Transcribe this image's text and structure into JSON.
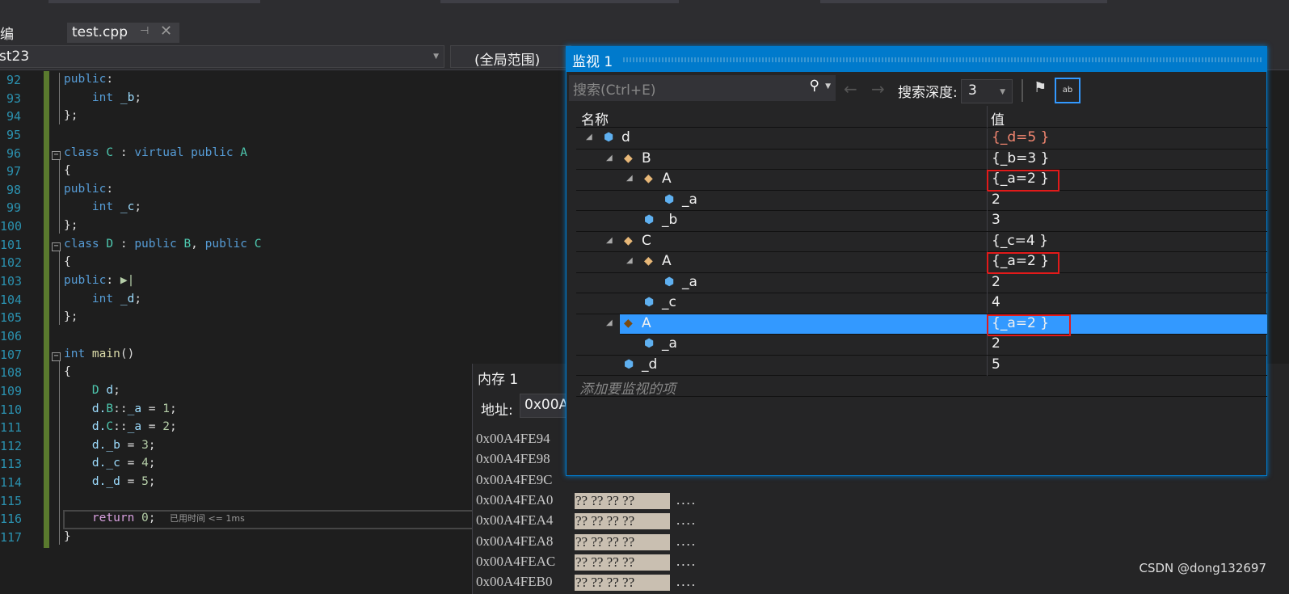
{
  "tabs": {
    "left_partial": "编",
    "active_file": "test.cpp",
    "pin_icon": "pin-icon",
    "close_icon": "close-icon"
  },
  "nav": {
    "project": "st23",
    "scope": "(全局范围)"
  },
  "editor": {
    "line_numbers": [
      "92",
      "93",
      "94",
      "95",
      "96",
      "97",
      "98",
      "99",
      "100",
      "101",
      "102",
      "103",
      "104",
      "105",
      "106",
      "107",
      "108",
      "109",
      "110",
      "111",
      "112",
      "113",
      "114",
      "115",
      "116",
      "117"
    ],
    "lines": [
      [
        [
          "public",
          "kw"
        ],
        [
          ":",
          "pl"
        ]
      ],
      [
        [
          "    int ",
          "kw"
        ],
        [
          "_b",
          "va"
        ],
        [
          ";",
          "pl"
        ]
      ],
      [
        [
          "};",
          "pl"
        ]
      ],
      [],
      [
        [
          "class ",
          "kw"
        ],
        [
          "C",
          "ty"
        ],
        [
          " : ",
          "pl"
        ],
        [
          "virtual public ",
          "kw"
        ],
        [
          "A",
          "ty"
        ]
      ],
      [
        [
          "{",
          "pl"
        ]
      ],
      [
        [
          "public",
          "kw"
        ],
        [
          ":",
          "pl"
        ]
      ],
      [
        [
          "    int ",
          "kw"
        ],
        [
          "_c",
          "va"
        ],
        [
          ";",
          "pl"
        ]
      ],
      [
        [
          "};",
          "pl"
        ]
      ],
      [
        [
          "class ",
          "kw"
        ],
        [
          "D",
          "ty"
        ],
        [
          " : ",
          "pl"
        ],
        [
          "public ",
          "kw"
        ],
        [
          "B",
          "ty"
        ],
        [
          ", ",
          "pl"
        ],
        [
          "public ",
          "kw"
        ],
        [
          "C",
          "ty"
        ]
      ],
      [
        [
          "{",
          "pl"
        ]
      ],
      [
        [
          "public",
          "kw"
        ],
        [
          ":",
          "pl"
        ],
        [
          " ▶|",
          "nu"
        ]
      ],
      [
        [
          "    int ",
          "kw"
        ],
        [
          "_d",
          "va"
        ],
        [
          ";",
          "pl"
        ]
      ],
      [
        [
          "};",
          "pl"
        ]
      ],
      [],
      [
        [
          "int ",
          "kw"
        ],
        [
          "main",
          "fn"
        ],
        [
          "()",
          "pl"
        ]
      ],
      [
        [
          "{",
          "pl"
        ]
      ],
      [
        [
          "    ",
          "pl"
        ],
        [
          "D ",
          "ty"
        ],
        [
          "d",
          "va"
        ],
        [
          ";",
          "pl"
        ]
      ],
      [
        [
          "    d.",
          "va"
        ],
        [
          "B",
          "ty"
        ],
        [
          "::",
          "pl"
        ],
        [
          "_a",
          "va"
        ],
        [
          " = ",
          "pl"
        ],
        [
          "1",
          "nu"
        ],
        [
          ";",
          "pl"
        ]
      ],
      [
        [
          "    d.",
          "va"
        ],
        [
          "C",
          "ty"
        ],
        [
          "::",
          "pl"
        ],
        [
          "_a",
          "va"
        ],
        [
          " = ",
          "pl"
        ],
        [
          "2",
          "nu"
        ],
        [
          ";",
          "pl"
        ]
      ],
      [
        [
          "    d.",
          "va"
        ],
        [
          "_b",
          "va"
        ],
        [
          " = ",
          "pl"
        ],
        [
          "3",
          "nu"
        ],
        [
          ";",
          "pl"
        ]
      ],
      [
        [
          "    d.",
          "va"
        ],
        [
          "_c",
          "va"
        ],
        [
          " = ",
          "pl"
        ],
        [
          "4",
          "nu"
        ],
        [
          ";",
          "pl"
        ]
      ],
      [
        [
          "    d.",
          "va"
        ],
        [
          "_d",
          "va"
        ],
        [
          " = ",
          "pl"
        ],
        [
          "5",
          "nu"
        ],
        [
          ";",
          "pl"
        ]
      ],
      [],
      [
        [
          "    return ",
          "rt"
        ],
        [
          "0",
          "nu"
        ],
        [
          ";",
          "pl"
        ]
      ],
      [
        [
          "}",
          "pl"
        ]
      ]
    ],
    "perf_hint": "已用时间 <= 1ms"
  },
  "memory": {
    "title": "内存 1",
    "address_label": "地址:",
    "address_value": "0x00A",
    "rows": [
      {
        "addr": "0x00A4FE94",
        "bytes": "",
        "chars": ""
      },
      {
        "addr": "0x00A4FE98",
        "bytes": "",
        "chars": ""
      },
      {
        "addr": "0x00A4FE9C",
        "bytes": "",
        "chars": ""
      },
      {
        "addr": "0x00A4FEA0",
        "bytes": "?? ?? ?? ??",
        "chars": "...."
      },
      {
        "addr": "0x00A4FEA4",
        "bytes": "?? ?? ?? ??",
        "chars": "...."
      },
      {
        "addr": "0x00A4FEA8",
        "bytes": "?? ?? ?? ??",
        "chars": "...."
      },
      {
        "addr": "0x00A4FEAC",
        "bytes": "?? ?? ?? ??",
        "chars": "...."
      },
      {
        "addr": "0x00A4FEB0",
        "bytes": "?? ?? ?? ??",
        "chars": "...."
      }
    ]
  },
  "watch": {
    "title": "监视 1",
    "search_placeholder": "搜索(Ctrl+E)",
    "depth_label": "搜索深度:",
    "depth_value": "3",
    "col_name": "名称",
    "col_value": "值",
    "add_item": "添加要监视的项",
    "rows": [
      {
        "depth": 0,
        "expander": true,
        "icon": "object-icon",
        "name": "d",
        "value": "{_d=5 }",
        "value_color": "#f48771"
      },
      {
        "depth": 1,
        "expander": true,
        "icon": "base-class-icon",
        "name": "B",
        "value": "{_b=3 }"
      },
      {
        "depth": 2,
        "expander": true,
        "icon": "base-class-icon",
        "name": "A",
        "value": "{_a=2 }",
        "highlighted": true
      },
      {
        "depth": 3,
        "expander": false,
        "icon": "object-icon",
        "name": "_a",
        "value": "2"
      },
      {
        "depth": 2,
        "expander": false,
        "icon": "object-icon",
        "name": "_b",
        "value": "3"
      },
      {
        "depth": 1,
        "expander": true,
        "icon": "base-class-icon",
        "name": "C",
        "value": "{_c=4 }"
      },
      {
        "depth": 2,
        "expander": true,
        "icon": "base-class-icon",
        "name": "A",
        "value": "{_a=2 }",
        "highlighted": true
      },
      {
        "depth": 3,
        "expander": false,
        "icon": "object-icon",
        "name": "_a",
        "value": "2"
      },
      {
        "depth": 2,
        "expander": false,
        "icon": "object-icon",
        "name": "_c",
        "value": "4"
      },
      {
        "depth": 1,
        "expander": true,
        "icon": "base-class-icon",
        "name": "A",
        "value": "{_a=2 }",
        "highlighted": true,
        "selected": true
      },
      {
        "depth": 2,
        "expander": false,
        "icon": "object-icon",
        "name": "_a",
        "value": "2"
      },
      {
        "depth": 1,
        "expander": false,
        "icon": "object-icon",
        "name": "_d",
        "value": "5"
      }
    ]
  },
  "colors": {
    "accent": "#007acc",
    "selection": "#3399ff",
    "highlight_box": "#e21a1a"
  },
  "watermark": "CSDN @dong132697"
}
